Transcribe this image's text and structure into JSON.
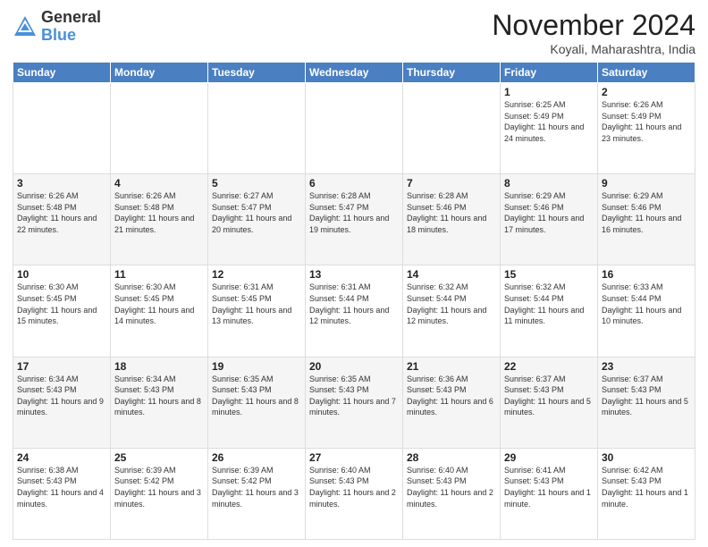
{
  "logo": {
    "general": "General",
    "blue": "Blue"
  },
  "header": {
    "month": "November 2024",
    "location": "Koyali, Maharashtra, India"
  },
  "days_of_week": [
    "Sunday",
    "Monday",
    "Tuesday",
    "Wednesday",
    "Thursday",
    "Friday",
    "Saturday"
  ],
  "weeks": [
    [
      {
        "day": "",
        "info": ""
      },
      {
        "day": "",
        "info": ""
      },
      {
        "day": "",
        "info": ""
      },
      {
        "day": "",
        "info": ""
      },
      {
        "day": "",
        "info": ""
      },
      {
        "day": "1",
        "info": "Sunrise: 6:25 AM\nSunset: 5:49 PM\nDaylight: 11 hours and 24 minutes."
      },
      {
        "day": "2",
        "info": "Sunrise: 6:26 AM\nSunset: 5:49 PM\nDaylight: 11 hours and 23 minutes."
      }
    ],
    [
      {
        "day": "3",
        "info": "Sunrise: 6:26 AM\nSunset: 5:48 PM\nDaylight: 11 hours and 22 minutes."
      },
      {
        "day": "4",
        "info": "Sunrise: 6:26 AM\nSunset: 5:48 PM\nDaylight: 11 hours and 21 minutes."
      },
      {
        "day": "5",
        "info": "Sunrise: 6:27 AM\nSunset: 5:47 PM\nDaylight: 11 hours and 20 minutes."
      },
      {
        "day": "6",
        "info": "Sunrise: 6:28 AM\nSunset: 5:47 PM\nDaylight: 11 hours and 19 minutes."
      },
      {
        "day": "7",
        "info": "Sunrise: 6:28 AM\nSunset: 5:46 PM\nDaylight: 11 hours and 18 minutes."
      },
      {
        "day": "8",
        "info": "Sunrise: 6:29 AM\nSunset: 5:46 PM\nDaylight: 11 hours and 17 minutes."
      },
      {
        "day": "9",
        "info": "Sunrise: 6:29 AM\nSunset: 5:46 PM\nDaylight: 11 hours and 16 minutes."
      }
    ],
    [
      {
        "day": "10",
        "info": "Sunrise: 6:30 AM\nSunset: 5:45 PM\nDaylight: 11 hours and 15 minutes."
      },
      {
        "day": "11",
        "info": "Sunrise: 6:30 AM\nSunset: 5:45 PM\nDaylight: 11 hours and 14 minutes."
      },
      {
        "day": "12",
        "info": "Sunrise: 6:31 AM\nSunset: 5:45 PM\nDaylight: 11 hours and 13 minutes."
      },
      {
        "day": "13",
        "info": "Sunrise: 6:31 AM\nSunset: 5:44 PM\nDaylight: 11 hours and 12 minutes."
      },
      {
        "day": "14",
        "info": "Sunrise: 6:32 AM\nSunset: 5:44 PM\nDaylight: 11 hours and 12 minutes."
      },
      {
        "day": "15",
        "info": "Sunrise: 6:32 AM\nSunset: 5:44 PM\nDaylight: 11 hours and 11 minutes."
      },
      {
        "day": "16",
        "info": "Sunrise: 6:33 AM\nSunset: 5:44 PM\nDaylight: 11 hours and 10 minutes."
      }
    ],
    [
      {
        "day": "17",
        "info": "Sunrise: 6:34 AM\nSunset: 5:43 PM\nDaylight: 11 hours and 9 minutes."
      },
      {
        "day": "18",
        "info": "Sunrise: 6:34 AM\nSunset: 5:43 PM\nDaylight: 11 hours and 8 minutes."
      },
      {
        "day": "19",
        "info": "Sunrise: 6:35 AM\nSunset: 5:43 PM\nDaylight: 11 hours and 8 minutes."
      },
      {
        "day": "20",
        "info": "Sunrise: 6:35 AM\nSunset: 5:43 PM\nDaylight: 11 hours and 7 minutes."
      },
      {
        "day": "21",
        "info": "Sunrise: 6:36 AM\nSunset: 5:43 PM\nDaylight: 11 hours and 6 minutes."
      },
      {
        "day": "22",
        "info": "Sunrise: 6:37 AM\nSunset: 5:43 PM\nDaylight: 11 hours and 5 minutes."
      },
      {
        "day": "23",
        "info": "Sunrise: 6:37 AM\nSunset: 5:43 PM\nDaylight: 11 hours and 5 minutes."
      }
    ],
    [
      {
        "day": "24",
        "info": "Sunrise: 6:38 AM\nSunset: 5:43 PM\nDaylight: 11 hours and 4 minutes."
      },
      {
        "day": "25",
        "info": "Sunrise: 6:39 AM\nSunset: 5:42 PM\nDaylight: 11 hours and 3 minutes."
      },
      {
        "day": "26",
        "info": "Sunrise: 6:39 AM\nSunset: 5:42 PM\nDaylight: 11 hours and 3 minutes."
      },
      {
        "day": "27",
        "info": "Sunrise: 6:40 AM\nSunset: 5:43 PM\nDaylight: 11 hours and 2 minutes."
      },
      {
        "day": "28",
        "info": "Sunrise: 6:40 AM\nSunset: 5:43 PM\nDaylight: 11 hours and 2 minutes."
      },
      {
        "day": "29",
        "info": "Sunrise: 6:41 AM\nSunset: 5:43 PM\nDaylight: 11 hours and 1 minute."
      },
      {
        "day": "30",
        "info": "Sunrise: 6:42 AM\nSunset: 5:43 PM\nDaylight: 11 hours and 1 minute."
      }
    ]
  ]
}
